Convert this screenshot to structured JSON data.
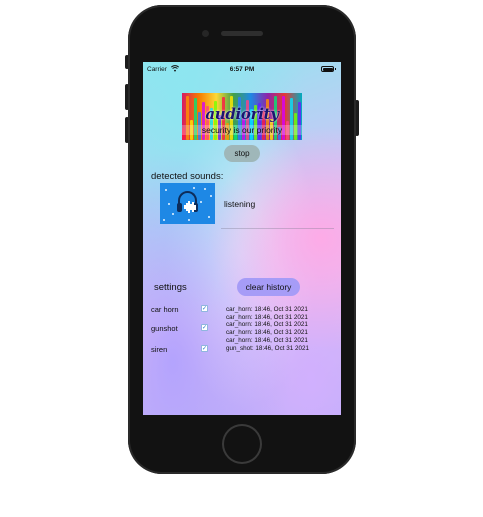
{
  "status_bar": {
    "carrier": "Carrier",
    "time": "6:57 PM"
  },
  "app": {
    "logo_text": "audiority",
    "tagline": "security is our priority",
    "stop_label": "stop",
    "detected_label": "detected sounds:",
    "listening_text": "listening",
    "settings_label": "settings",
    "clear_history_label": "clear history"
  },
  "settings": [
    {
      "name": "car horn",
      "checked": true
    },
    {
      "name": "gunshot",
      "checked": true
    },
    {
      "name": "siren",
      "checked": true
    }
  ],
  "history": [
    "car_horn: 18:46, Oct 31 2021",
    "car_horn: 18:46, Oct 31 2021",
    "car_horn: 18:46, Oct 31 2021",
    "car_horn: 18:46, Oct 31 2021",
    "car_horn: 18:46, Oct 31 2021",
    "gun_shot: 18:46, Oct 31 2021"
  ],
  "icons": {
    "wifi": "wifi-icon",
    "battery": "battery-icon",
    "checkbox": "checkmark-icon",
    "sound": "headphones-icon"
  },
  "colors": {
    "stop_button": "#9fb7b9",
    "clear_button": "#a69cf7",
    "sound_card": "#1e88e5"
  }
}
